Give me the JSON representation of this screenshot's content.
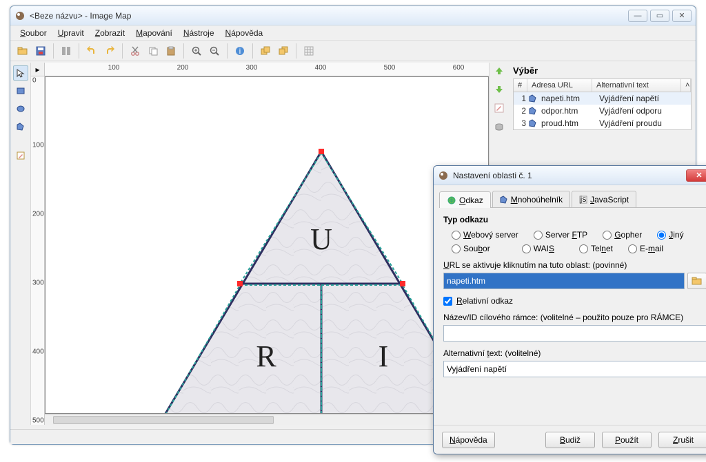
{
  "window": {
    "title": "<Beze názvu> - Image Map"
  },
  "menu": {
    "soubor": "Soubor",
    "upravit": "Upravit",
    "zobrazit": "Zobrazit",
    "mapovani": "Mapování",
    "nastroje": "Nástroje",
    "napoveda": "Nápověda"
  },
  "ruler": {
    "m100": "100",
    "m200": "200",
    "m300": "300",
    "m400": "400",
    "m500": "500",
    "m600": "600",
    "v0": "0",
    "v100": "100",
    "v200": "200",
    "v300": "300",
    "v400": "400",
    "v500": "500"
  },
  "triangle": {
    "U": "U",
    "R": "R",
    "I": "I"
  },
  "selection": {
    "title": "Výběr",
    "col_num": "#",
    "col_url": "Adresa URL",
    "col_alt": "Alternativní text",
    "rows": [
      {
        "n": "1",
        "url": "napeti.htm",
        "alt": "Vyjádření napětí"
      },
      {
        "n": "2",
        "url": "odpor.htm",
        "alt": "Vyjádření odporu"
      },
      {
        "n": "3",
        "url": "proud.htm",
        "alt": "Vyjádření proudu"
      }
    ]
  },
  "dialog": {
    "title": "Nastavení oblasti č. 1",
    "tabs": {
      "odkaz": "Odkaz",
      "mnoh": "Mnohoúhelník",
      "js": "JavaScript"
    },
    "group": "Typ odkazu",
    "radios": {
      "web": "Webový server",
      "ftp": "Server FTP",
      "gopher": "Gopher",
      "jiny": "Jiný",
      "soubor": "Soubor",
      "wais": "WAIS",
      "telnet": "Telnet",
      "email": "E-mail"
    },
    "url_label": "URL se aktivuje kliknutím na tuto oblast: (povinné)",
    "url_value": "napeti.htm",
    "rel_label": "Relativní odkaz",
    "frame_label": "Název/ID cílového rámce: (volitelné – použito pouze pro RÁMCE)",
    "frame_value": "",
    "alt_label": "Alternativní text: (volitelné)",
    "alt_value": "Vyjádření napětí",
    "btn_help": "Nápověda",
    "btn_ok": "Budiž",
    "btn_apply": "Použít",
    "btn_cancel": "Zrušit"
  }
}
